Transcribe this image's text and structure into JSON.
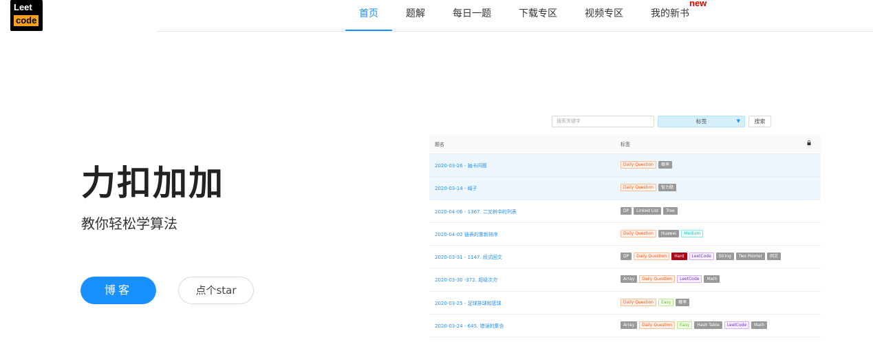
{
  "logo": {
    "line1": "Leet",
    "line2": "code"
  },
  "nav": {
    "items": [
      {
        "label": "首页",
        "active": true
      },
      {
        "label": "题解",
        "active": false
      },
      {
        "label": "每日一题",
        "active": false
      },
      {
        "label": "下载专区",
        "active": false
      },
      {
        "label": "视频专区",
        "active": false
      },
      {
        "label": "我的新书",
        "active": false
      }
    ],
    "new_badge": "new"
  },
  "hero": {
    "title": "力扣加加",
    "subtitle": "教你轻松学算法",
    "blog_button": "博客",
    "star_button": "点个star"
  },
  "preview": {
    "search_placeholder": "搜索关键字",
    "tag_select": "标签",
    "search_button": "搜索",
    "columns": [
      "题名",
      "标签"
    ],
    "rows": [
      {
        "title": "2020-03-26 - 抽卡问题",
        "tags": [
          {
            "text": "Daily Question",
            "color": "orange"
          },
          {
            "text": "概率",
            "color": "grey"
          }
        ]
      },
      {
        "title": "2020-03-14 - 绳子",
        "tags": [
          {
            "text": "Daily Question",
            "color": "orange"
          },
          {
            "text": "智力题",
            "color": "grey"
          }
        ]
      },
      {
        "title": "2020-04-06 - 1367. 二叉树中的列表",
        "tags": [
          {
            "text": "DP",
            "color": "grey"
          },
          {
            "text": "Linked List",
            "color": "grey"
          },
          {
            "text": "Tree",
            "color": "grey"
          }
        ]
      },
      {
        "title": "2020-04-02 链表的重新排序",
        "tags": [
          {
            "text": "Daily Question",
            "color": "orange"
          },
          {
            "text": "Huawei",
            "color": "grey"
          },
          {
            "text": "Medium",
            "color": "cyan"
          }
        ]
      },
      {
        "title": "2020-03-31 - 1147. 段式回文",
        "tags": [
          {
            "text": "DP",
            "color": "grey"
          },
          {
            "text": "Daily Question",
            "color": "orange"
          },
          {
            "text": "Hard",
            "color": "darkred"
          },
          {
            "text": "LeetCode",
            "color": "purple"
          },
          {
            "text": "String",
            "color": "grey"
          },
          {
            "text": "Two Pointer",
            "color": "grey"
          },
          {
            "text": "回文",
            "color": "grey"
          }
        ]
      },
      {
        "title": "2020-03-30 -372. 超级次方",
        "tags": [
          {
            "text": "Array",
            "color": "grey"
          },
          {
            "text": "Daily Question",
            "color": "orange"
          },
          {
            "text": "LeetCode",
            "color": "purple"
          },
          {
            "text": "Math",
            "color": "grey"
          }
        ]
      },
      {
        "title": "2020-03-25 - 足球排球和篮球",
        "tags": [
          {
            "text": "Daily Question",
            "color": "orange"
          },
          {
            "text": "Easy",
            "color": "green"
          },
          {
            "text": "概率",
            "color": "grey"
          }
        ]
      },
      {
        "title": "2020-03-24 - 645. 错误的集合",
        "tags": [
          {
            "text": "Array",
            "color": "grey"
          },
          {
            "text": "Daily Question",
            "color": "orange"
          },
          {
            "text": "Easy",
            "color": "green"
          },
          {
            "text": "Hash Table",
            "color": "grey"
          },
          {
            "text": "LeetCode",
            "color": "purple"
          },
          {
            "text": "Math",
            "color": "grey"
          }
        ]
      }
    ],
    "highlight_rows": [
      0,
      1
    ]
  }
}
